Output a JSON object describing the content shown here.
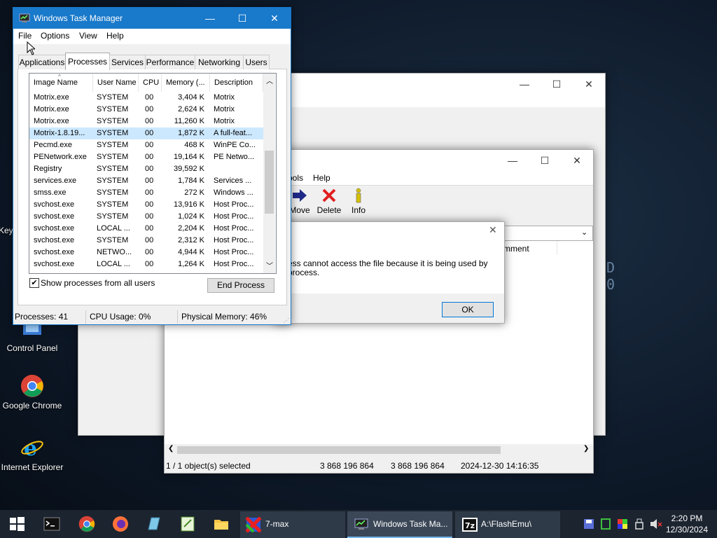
{
  "desktop": {
    "icons": [
      {
        "label": "Control Panel"
      },
      {
        "label": "Google Chrome"
      },
      {
        "label": "Internet Explorer"
      }
    ],
    "partial_label": "Key",
    "deco": [
      "D",
      "0"
    ]
  },
  "back_window": {
    "min": "—",
    "max": "☐",
    "close": "✕"
  },
  "sevenzip": {
    "menu_partial": "ools",
    "menu_help": "Help",
    "tools": [
      {
        "label": "Move",
        "icon": "arrow-right-icon",
        "color": "#1f2a8a"
      },
      {
        "label": "Delete",
        "icon": "red-x-icon",
        "color": "#e02020"
      },
      {
        "label": "Info",
        "icon": "info-icon",
        "color": "#d4c000"
      }
    ],
    "col_header": "mment",
    "status": {
      "selected": "1 / 1 object(s) selected",
      "size": "3 868 196 864",
      "packed": "3 868 196 864",
      "modified": "2024-12-30 14:16:35"
    }
  },
  "error_dialog": {
    "line1": "ess cannot access the file because it is being used by",
    "line2": "process.",
    "ok": "OK"
  },
  "taskmgr": {
    "title": "Windows Task Manager",
    "menu": [
      "File",
      "Options",
      "View",
      "Help"
    ],
    "tabs": [
      "Applications",
      "Processes",
      "Services",
      "Performance",
      "Networking",
      "Users"
    ],
    "active_tab": "Processes",
    "columns": [
      "Image Name",
      "User Name",
      "CPU",
      "Memory (...",
      "Description"
    ],
    "rows": [
      {
        "name": "Motrix.exe",
        "user": "SYSTEM",
        "cpu": "00",
        "mem": "3,404 K",
        "desc": "Motrix"
      },
      {
        "name": "Motrix.exe",
        "user": "SYSTEM",
        "cpu": "00",
        "mem": "2,624 K",
        "desc": "Motrix"
      },
      {
        "name": "Motrix.exe",
        "user": "SYSTEM",
        "cpu": "00",
        "mem": "11,260 K",
        "desc": "Motrix"
      },
      {
        "name": "Motrix-1.8.19...",
        "user": "SYSTEM",
        "cpu": "00",
        "mem": "1,872 K",
        "desc": "A full-feat..."
      },
      {
        "name": "Pecmd.exe",
        "user": "SYSTEM",
        "cpu": "00",
        "mem": "468 K",
        "desc": "WinPE Co..."
      },
      {
        "name": "PENetwork.exe",
        "user": "SYSTEM",
        "cpu": "00",
        "mem": "19,164 K",
        "desc": "PE Netwo..."
      },
      {
        "name": "Registry",
        "user": "SYSTEM",
        "cpu": "00",
        "mem": "39,592 K",
        "desc": ""
      },
      {
        "name": "services.exe",
        "user": "SYSTEM",
        "cpu": "00",
        "mem": "1,784 K",
        "desc": "Services ..."
      },
      {
        "name": "smss.exe",
        "user": "SYSTEM",
        "cpu": "00",
        "mem": "272 K",
        "desc": "Windows ..."
      },
      {
        "name": "svchost.exe",
        "user": "SYSTEM",
        "cpu": "00",
        "mem": "13,916 K",
        "desc": "Host Proc..."
      },
      {
        "name": "svchost.exe",
        "user": "SYSTEM",
        "cpu": "00",
        "mem": "1,024 K",
        "desc": "Host Proc..."
      },
      {
        "name": "svchost.exe",
        "user": "LOCAL ...",
        "cpu": "00",
        "mem": "2,204 K",
        "desc": "Host Proc..."
      },
      {
        "name": "svchost.exe",
        "user": "SYSTEM",
        "cpu": "00",
        "mem": "2,312 K",
        "desc": "Host Proc..."
      },
      {
        "name": "svchost.exe",
        "user": "NETWO...",
        "cpu": "00",
        "mem": "4,944 K",
        "desc": "Host Proc..."
      },
      {
        "name": "svchost.exe",
        "user": "LOCAL ...",
        "cpu": "00",
        "mem": "1,264 K",
        "desc": "Host Proc..."
      }
    ],
    "selected_row": 3,
    "show_all_label": "Show processes from all users",
    "show_all_checked": true,
    "end_process": "End Process",
    "status": {
      "processes": "Processes: 41",
      "cpu": "CPU Usage: 0%",
      "memory": "Physical Memory: 46%"
    }
  },
  "taskbar": {
    "tasks": [
      {
        "label": "7-max"
      },
      {
        "label": "Windows Task Ma..."
      },
      {
        "label": "A:\\FlashEmu\\"
      }
    ],
    "clock_time": "2:20 PM",
    "clock_date": "12/30/2024"
  },
  "colors": {
    "accent": "#1979ca",
    "selection": "#cce8ff",
    "taskbar": "#1c2430"
  }
}
